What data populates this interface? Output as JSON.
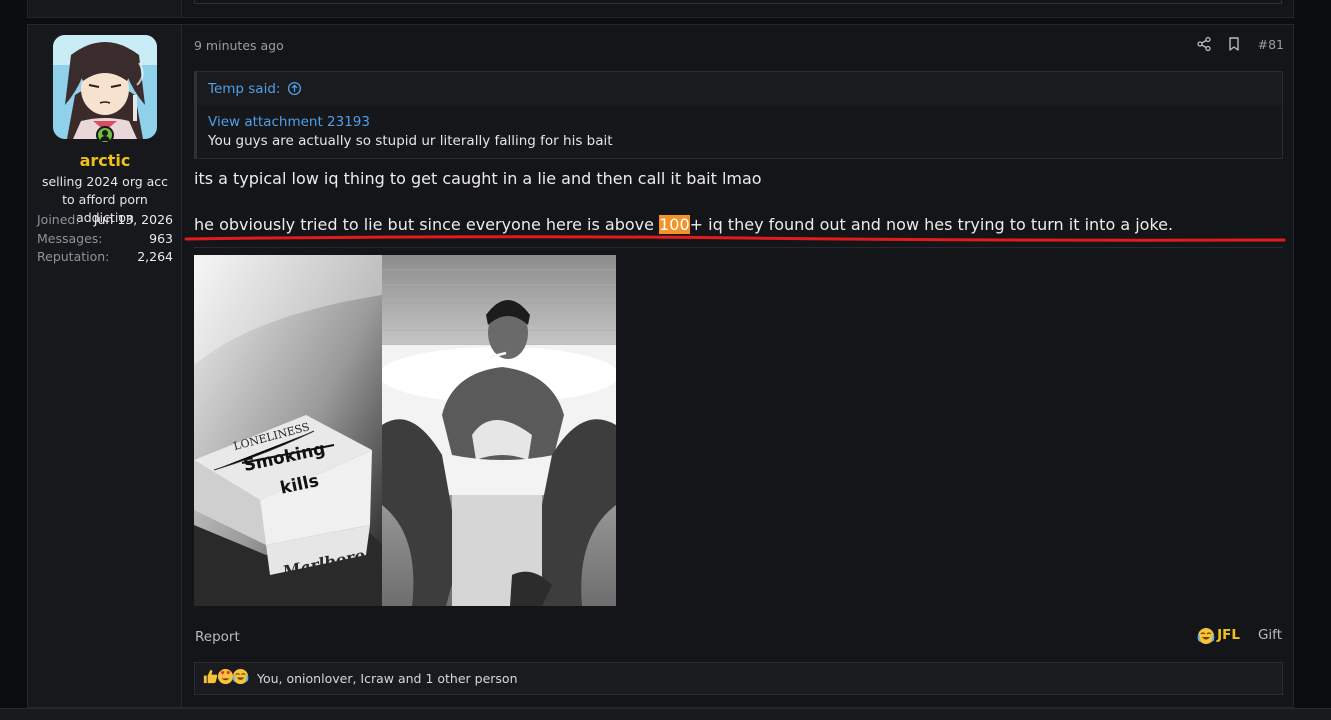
{
  "post": {
    "time": "9 minutes ago",
    "number": "#81",
    "author": {
      "name": "arctic",
      "title": "selling 2024 org acc to afford porn addiction",
      "stats": [
        {
          "label": "Joined:",
          "value": "Jun 13, 2026"
        },
        {
          "label": "Messages:",
          "value": "963"
        },
        {
          "label": "Reputation:",
          "value": "2,264"
        }
      ],
      "online": true
    },
    "quote": {
      "author_label": "Temp said:",
      "attachment_link": "View attachment 23193",
      "text": "You guys are actually so stupid ur literally falling for his bait"
    },
    "body": {
      "line1": "its a typical low iq thing to get caught in a lie and then call it bait lmao",
      "line2_before": "he obviously tried to lie but since everyone here is above ",
      "line2_highlight": "100",
      "line2_after": "+ iq they found out and now hes trying to turn it into a joke."
    },
    "images": {
      "left_pack_text_top": "LONELINESS",
      "left_pack_text_struck": "Smoking",
      "left_pack_text_main": "kills",
      "left_pack_brand": "Marlboro"
    },
    "footer": {
      "report_label": "Report",
      "reaction_label": "JFL",
      "gift_label": "Gift"
    },
    "reactions": {
      "summary": "You, onionlover, Icraw and 1 other person"
    }
  },
  "colors": {
    "username": "#f2c119",
    "link": "#4f9fe6",
    "highlight": "#f39227",
    "annotation_line": "#e21b1b",
    "online": "#6fbf3b"
  }
}
